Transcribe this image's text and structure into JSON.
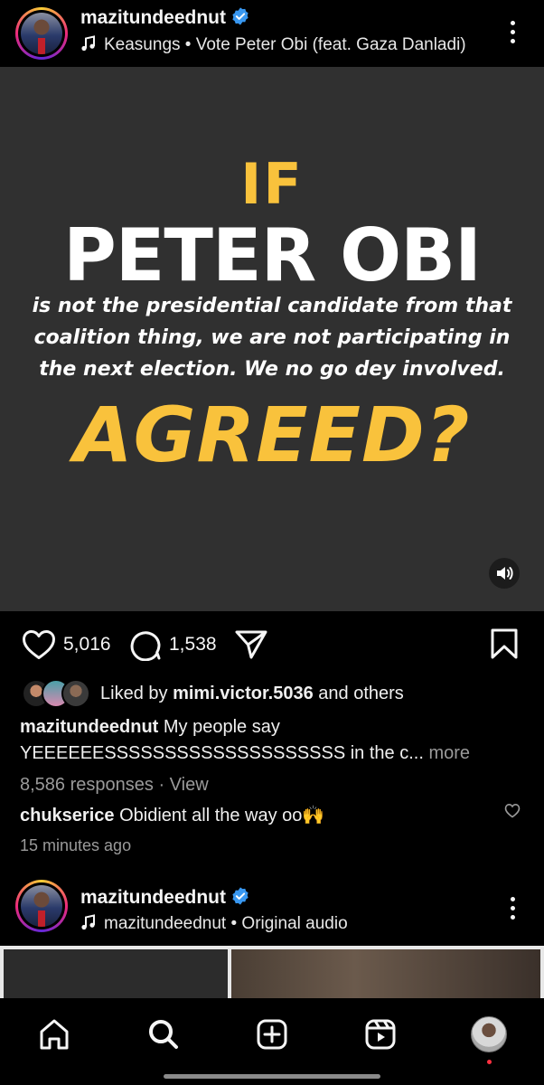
{
  "post1": {
    "username": "mazitundeednut",
    "audio_artist": "Keasungs",
    "audio_separator": " • ",
    "audio_title": "Vote Peter Obi (feat. Gaza Danladi)",
    "poster": {
      "line_if": "IF",
      "line_name": "PETER OBI",
      "body_line1": "is not the presidential candidate from that",
      "body_line2": "coalition thing, we are not participating in",
      "body_line3": "the next election. We no go dey involved.",
      "line_question": "AGREED?",
      "accent_color": "#f9c23c"
    },
    "likes": "5,016",
    "comments": "1,538",
    "liked_by_prefix": "Liked by ",
    "liked_by_user": "mimi.victor.5036",
    "liked_by_suffix": " and others",
    "caption_user": "mazitundeednut",
    "caption_line1": " My people say",
    "caption_line2": "YEEEEEESSSSSSSSSSSSSSSSSSSS in the c...",
    "caption_more": " more",
    "responses": "8,586 responses",
    "responses_sep": " · ",
    "view_label": "View",
    "comment_user": "chukserice",
    "comment_text": " Obidient all the way oo🙌",
    "time_ago": "15 minutes ago"
  },
  "post2": {
    "username": "mazitundeednut",
    "audio_text": "mazitundeednut • Original audio"
  },
  "icons": {
    "verified": "verified-badge-icon",
    "music": "music-note-icon",
    "more": "more-dots-icon",
    "heart": "heart-icon",
    "comment": "comment-bubble-icon",
    "share": "paper-plane-icon",
    "save": "bookmark-icon",
    "sound": "speaker-icon",
    "home": "home-icon",
    "search": "search-icon",
    "create": "plus-square-icon",
    "reels": "reels-icon",
    "profile": "profile-avatar"
  },
  "colors": {
    "verified_blue": "#3897f0",
    "background": "#000000",
    "poster_bg": "#303030",
    "poster_yellow": "#f9c23c"
  }
}
